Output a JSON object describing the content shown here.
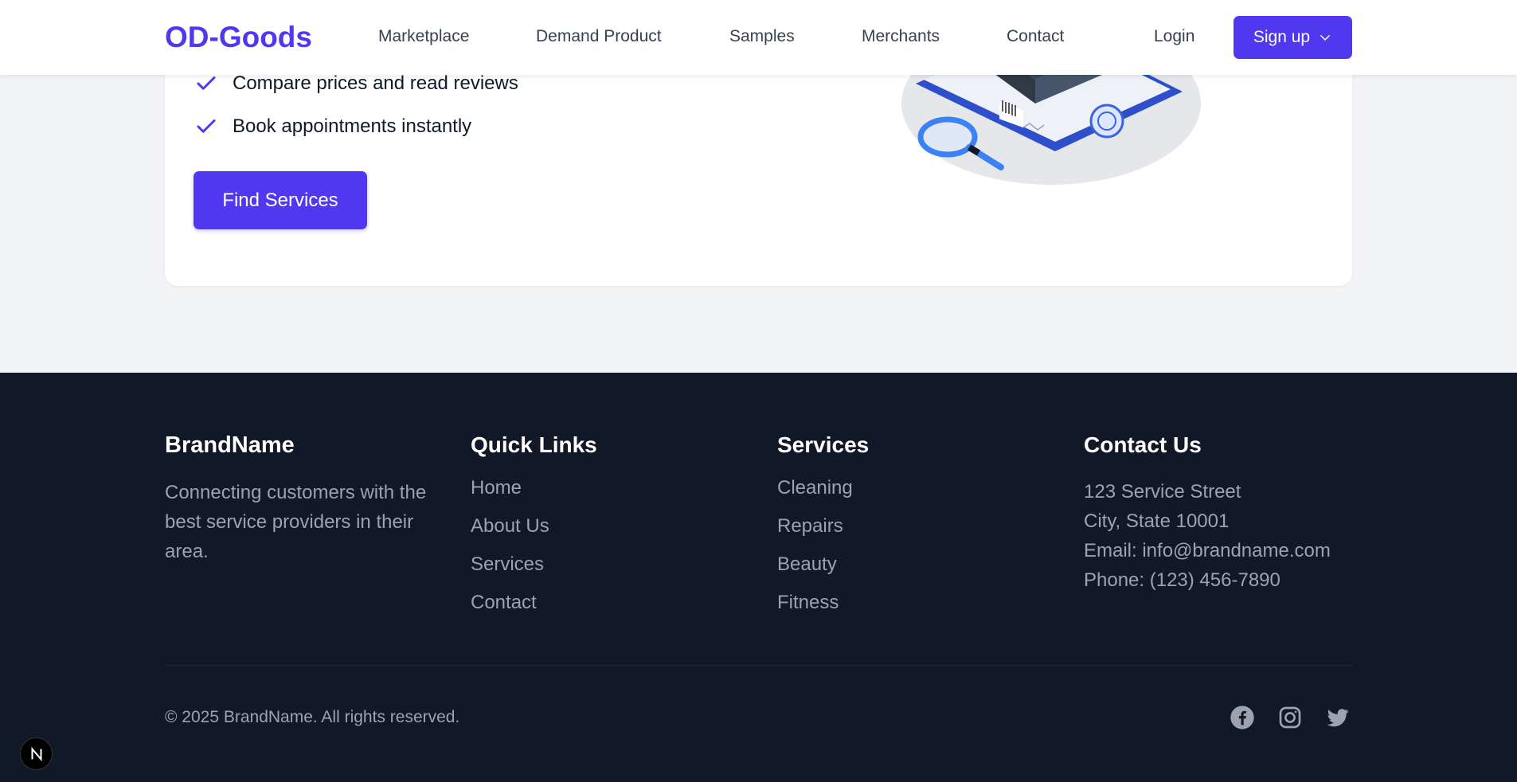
{
  "header": {
    "logo": "OD-Goods",
    "nav": [
      "Marketplace",
      "Demand Product",
      "Samples",
      "Merchants",
      "Contact"
    ],
    "login": "Login",
    "signup": "Sign up"
  },
  "hero": {
    "features": [
      "Compare prices and read reviews",
      "Book appointments instantly"
    ],
    "cta": "Find Services"
  },
  "footer": {
    "brand": {
      "title": "BrandName",
      "text": "Connecting customers with the best service providers in their area."
    },
    "quick_links": {
      "title": "Quick Links",
      "items": [
        "Home",
        "About Us",
        "Services",
        "Contact"
      ]
    },
    "services": {
      "title": "Services",
      "items": [
        "Cleaning",
        "Repairs",
        "Beauty",
        "Fitness"
      ]
    },
    "contact": {
      "title": "Contact Us",
      "lines": [
        "123 Service Street",
        "City, State 10001",
        "Email: info@brandname.com",
        "Phone: (123) 456-7890"
      ]
    },
    "copyright": "© 2025 BrandName. All rights reserved.",
    "social": [
      "facebook-icon",
      "instagram-icon",
      "twitter-icon"
    ]
  },
  "colors": {
    "accent": "#4f38f0",
    "footer_bg": "#111827",
    "muted": "#9ca3af"
  }
}
